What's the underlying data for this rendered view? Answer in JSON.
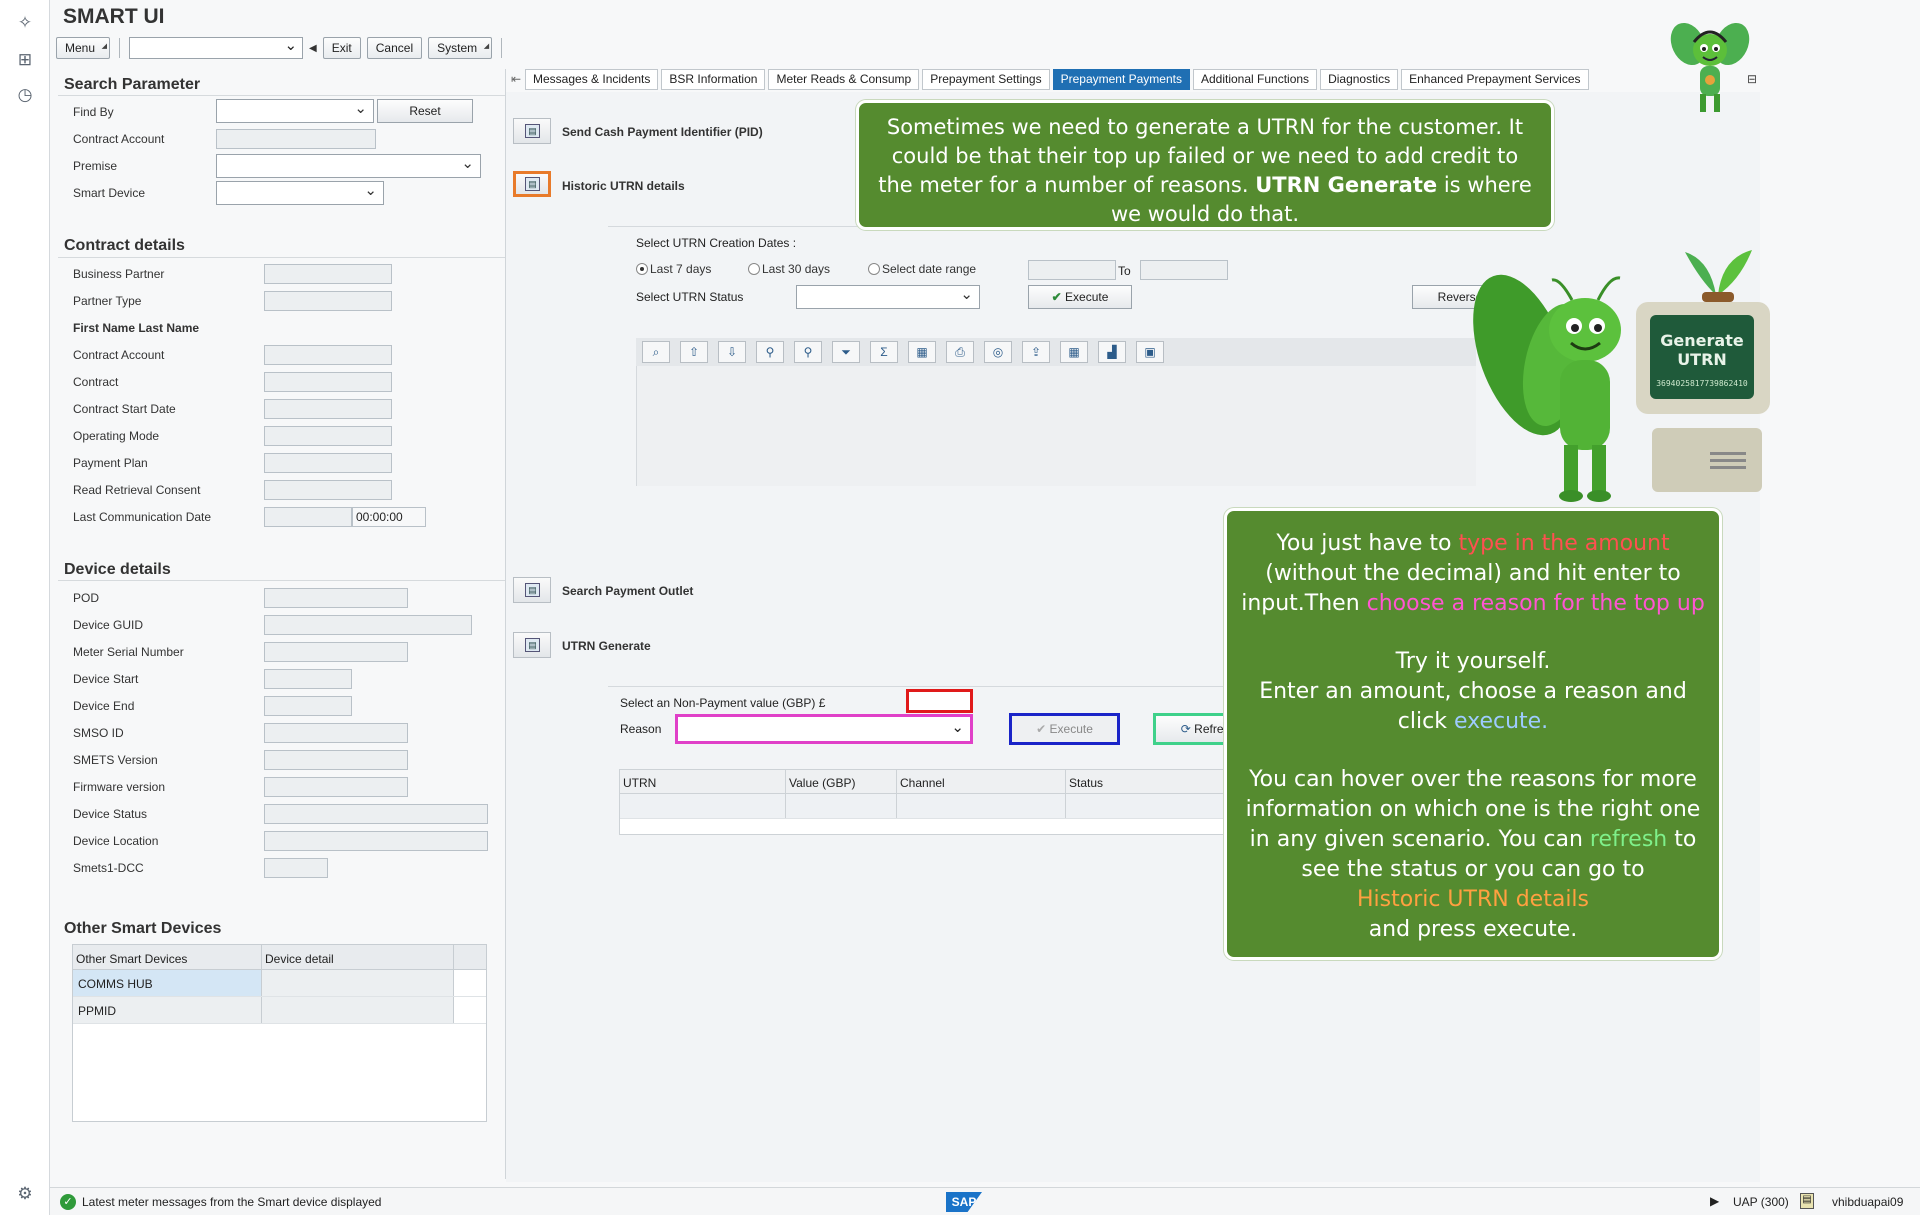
{
  "app": {
    "title": "SMART UI"
  },
  "toolbar": {
    "menu": "Menu",
    "exit": "Exit",
    "cancel": "Cancel",
    "system": "System"
  },
  "search": {
    "header": "Search Parameter",
    "find_by": "Find By",
    "reset": "Reset",
    "contract_account": "Contract Account",
    "premise": "Premise",
    "smart_device": "Smart Device"
  },
  "contract": {
    "header": "Contract details",
    "fields": [
      "Business Partner",
      "Partner Type",
      "First Name Last Name",
      "Contract Account",
      "Contract",
      "Contract Start Date",
      "Operating Mode",
      "Payment Plan",
      "Read Retrieval Consent",
      "Last Communication Date"
    ],
    "time_value": "00:00:00"
  },
  "device": {
    "header": "Device details",
    "fields": [
      "POD",
      "Device GUID",
      "Meter Serial Number",
      "Device Start",
      "Device End",
      "SMSO ID",
      "SMETS Version",
      "Firmware version",
      "Device Status",
      "Device Location",
      "Smets1-DCC"
    ]
  },
  "other_devices": {
    "header": "Other Smart Devices",
    "columns": [
      "Other Smart Devices",
      "Device detail"
    ],
    "rows": [
      "COMMS HUB",
      "PPMID"
    ]
  },
  "tabs": [
    "Messages & Incidents",
    "BSR Information",
    "Meter Reads & Consump",
    "Prepayment Settings",
    "Prepayment Payments",
    "Additional Functions",
    "Diagnostics",
    "Enhanced Prepayment Services"
  ],
  "main": {
    "send_cash": "Send Cash Payment Identifier (PID)",
    "historic": "Historic UTRN details",
    "select_dates": "Select UTRN Creation Dates :",
    "last7": "Last 7 days",
    "last30": "Last 30 days",
    "range": "Select date range",
    "to": "To",
    "status_label": "Select UTRN Status",
    "execute": "Execute",
    "reverse": "Reverse",
    "search_outlet": "Search Payment Outlet",
    "utrn_generate": "UTRN Generate",
    "non_payment": "Select an Non-Payment value (GBP) £",
    "reason": "Reason",
    "execute2": "Execute",
    "refresh": "Refresh",
    "utrn_columns": [
      "UTRN",
      "Value (GBP)",
      "Channel",
      "Status"
    ]
  },
  "illustration": {
    "screen_title": "Generate UTRN",
    "screen_number": "369402581773986241 0"
  },
  "callout1": {
    "text_a": "Sometimes we need to generate a UTRN for the customer. It could be that their top up failed or we need to add credit to the meter for a number of reasons. ",
    "text_bold": "UTRN Generate",
    "text_b": " is where we would do that."
  },
  "callout2": {
    "l1a": "You just have to ",
    "l1b": "type in the amount",
    "l2": "(without the decimal) and hit enter to",
    "l3a": "input.Then ",
    "l3b": "choose a reason for the top up",
    "l4": "Try it yourself.",
    "l5": "Enter an amount, choose a reason and",
    "l6a": "click ",
    "l6b": "execute.",
    "l7": "You can hover over the reasons for more",
    "l8": "information on which one is the right one",
    "l9a": "in any given scenario. You can ",
    "l9b": "refresh",
    "l9c": " to",
    "l10": "see the status or you can go to",
    "l11": "Historic UTRN details",
    "l12": "and press execute."
  },
  "status": {
    "message": "Latest meter messages from the Smart device displayed",
    "system": "UAP (300)",
    "user": "vhibduapai09",
    "brand": "SAP"
  },
  "colors": {
    "accent": "#1f6fb3",
    "callout_bg": "#558b2f",
    "highlight_orange": "#e87a2a",
    "highlight_red": "#e01a1a",
    "highlight_pink": "#e040c8",
    "highlight_blue": "#1a24c8",
    "highlight_green": "#3fd18a"
  }
}
